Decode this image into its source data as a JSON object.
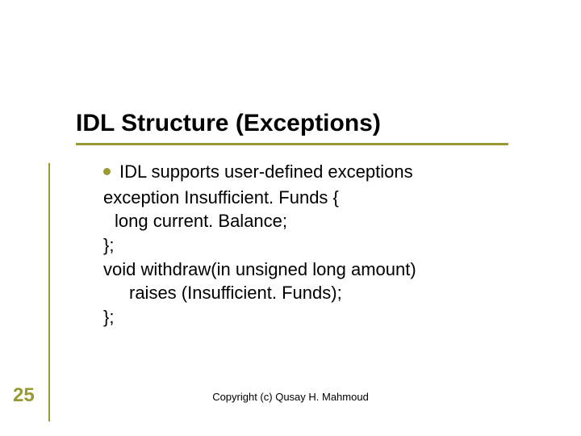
{
  "title": "IDL Structure (Exceptions)",
  "bullet": "IDL supports user-defined exceptions",
  "lines": {
    "l1": "exception Insufficient. Funds {",
    "l2": "long current. Balance;",
    "l3": "};",
    "l4": "void withdraw(in unsigned long amount)",
    "l5": "raises (Insufficient. Funds);",
    "l6": "};"
  },
  "page_number": "25",
  "copyright": "Copyright (c) Qusay H. Mahmoud"
}
